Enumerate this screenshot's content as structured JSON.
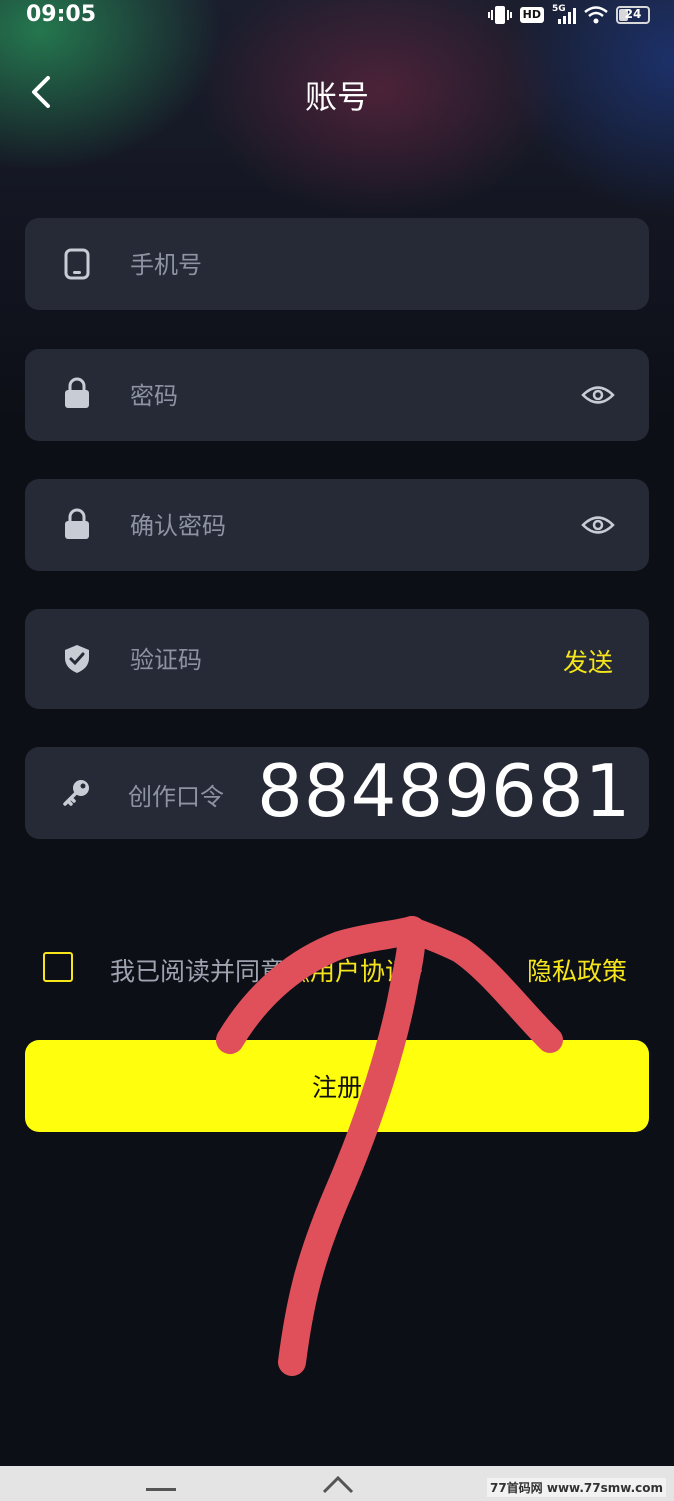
{
  "status_bar": {
    "time": "09:05",
    "hd_label": "HD",
    "network_label": "5G",
    "battery": "24"
  },
  "header": {
    "title": "账号"
  },
  "form": {
    "phone_placeholder": "手机号",
    "password_placeholder": "密码",
    "confirm_password_placeholder": "确认密码",
    "verify_code_placeholder": "验证码",
    "send_label": "发送",
    "creation_code_label": "创作口令",
    "creation_code_value": "88489681"
  },
  "agreement": {
    "prefix": "我已阅读并同意",
    "user_agreement": "《用户协议》",
    "privacy_policy": "隐私政策"
  },
  "register_label": "注册",
  "watermark": "77首码网 www.77smw.com",
  "colors": {
    "accent": "#f5e51a",
    "button": "#ffff0d",
    "field_bg": "#262a36",
    "page_bg": "#0d0f17",
    "annotation": "#e0505a"
  },
  "icons": {
    "back": "chevron-left-icon",
    "phone": "phone-icon",
    "lock": "lock-icon",
    "eye": "eye-icon",
    "shield": "shield-check-icon",
    "key": "key-icon"
  }
}
